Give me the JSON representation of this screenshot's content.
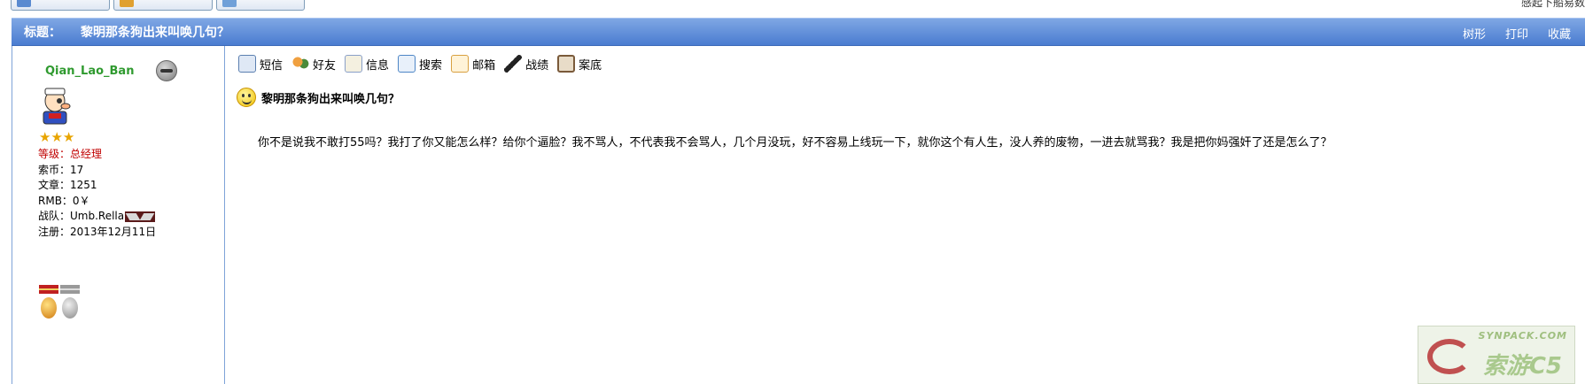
{
  "top_right_text": "感起下船易数",
  "title_bar": {
    "label": "标题：",
    "title": "黎明那条狗出来叫唤几句？",
    "actions": [
      "树形",
      "打印",
      "收藏"
    ]
  },
  "user": {
    "username": "Qian_Lao_Ban",
    "stars": "★★★",
    "rank_label": "等级：",
    "rank_value": "总经理",
    "coins": "索币：17",
    "posts": "文章：1251",
    "rmb": "RMB：0￥",
    "team": "战队：Umb.Rella",
    "registered": "注册：2013年12月11日"
  },
  "toolbar": [
    {
      "label": "短信",
      "icon": "message-icon",
      "color": "#5b7fb0"
    },
    {
      "label": "好友",
      "icon": "friends-icon",
      "color": "#c8781e"
    },
    {
      "label": "信息",
      "icon": "info-icon",
      "color": "#8aa0c8"
    },
    {
      "label": "搜索",
      "icon": "search-icon",
      "color": "#4e86c6"
    },
    {
      "label": "邮箱",
      "icon": "mail-icon",
      "color": "#d8a040"
    },
    {
      "label": "战绩",
      "icon": "record-icon",
      "color": "#222222"
    },
    {
      "label": "案底",
      "icon": "file-icon",
      "color": "#7a5a3a"
    }
  ],
  "post": {
    "title": "黎明那条狗出来叫唤几句？",
    "body": "你不是说我不敢打55吗？我打了你又能怎么样？给你个逼脸？我不骂人，不代表我不会骂人，几个月没玩，好不容易上线玩一下，就你这个有人生，没人养的废物，一进去就骂我？我是把你妈强奸了还是怎么了？"
  },
  "watermark": {
    "url_text": "SYNPACK.COM",
    "cn_text": "索游C5"
  }
}
